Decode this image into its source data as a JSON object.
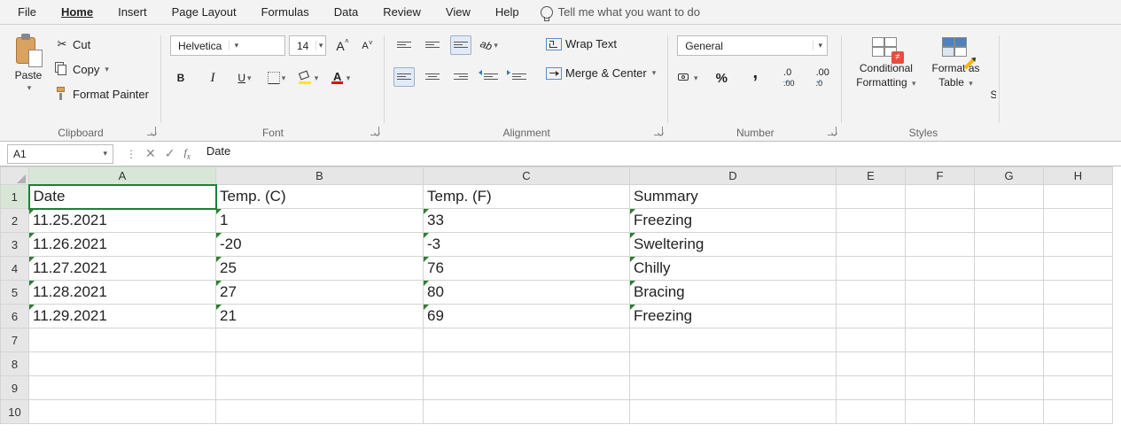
{
  "menu": {
    "items": [
      "File",
      "Home",
      "Insert",
      "Page Layout",
      "Formulas",
      "Data",
      "Review",
      "View",
      "Help"
    ],
    "active": "Home",
    "tell_me": "Tell me what you want to do"
  },
  "ribbon": {
    "clipboard": {
      "label": "Clipboard",
      "paste": "Paste",
      "cut": "Cut",
      "copy": "Copy",
      "format_painter": "Format Painter"
    },
    "font": {
      "label": "Font",
      "name": "Helvetica",
      "size": "14"
    },
    "alignment": {
      "label": "Alignment",
      "wrap": "Wrap Text",
      "merge": "Merge & Center"
    },
    "number": {
      "label": "Number",
      "format": "General"
    },
    "styles": {
      "label": "Styles",
      "cf1": "Conditional",
      "cf2": "Formatting",
      "fat1": "Format as",
      "fat2": "Table"
    }
  },
  "namebox": "A1",
  "formula": "Date",
  "columns": [
    "A",
    "B",
    "C",
    "D",
    "E",
    "F",
    "G",
    "H"
  ],
  "headers": [
    "Date",
    "Temp. (C)",
    "Temp. (F)",
    "Summary"
  ],
  "rows": [
    {
      "date": "11.25.2021",
      "c": "1",
      "f": "33",
      "s": "Freezing"
    },
    {
      "date": "11.26.2021",
      "c": "-20",
      "f": "-3",
      "s": "Sweltering"
    },
    {
      "date": "11.27.2021",
      "c": "25",
      "f": "76",
      "s": "Chilly"
    },
    {
      "date": "11.28.2021",
      "c": "27",
      "f": "80",
      "s": "Bracing"
    },
    {
      "date": "11.29.2021",
      "c": "21",
      "f": "69",
      "s": "Freezing"
    }
  ],
  "row_count": 10
}
